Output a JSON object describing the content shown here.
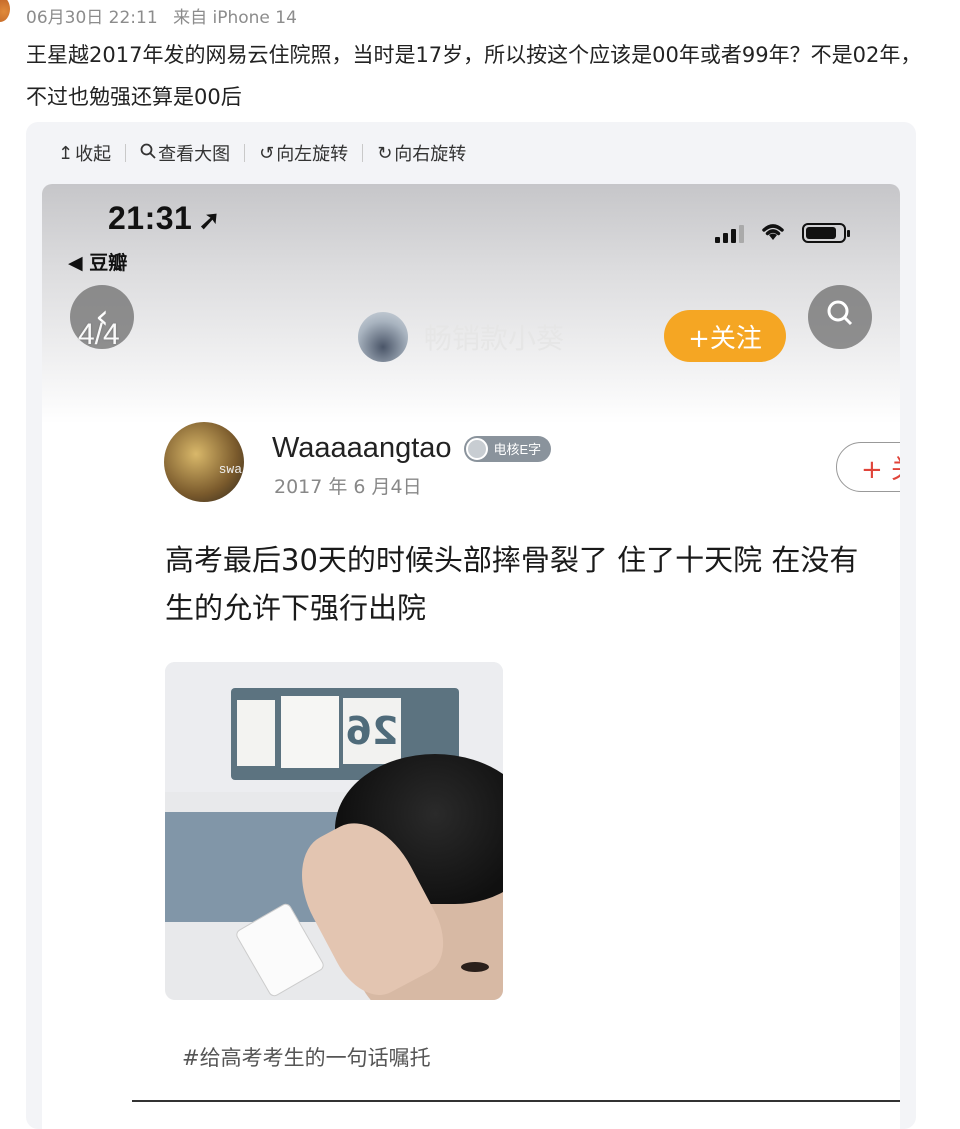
{
  "post": {
    "date": "06月30日 22:11",
    "source": "来自 iPhone 14",
    "text": "王星越2017年发的网易云住院照，当时是17岁，所以按这个应该是00年或者99年？不是02年，不过也勉强还算是00后"
  },
  "toolbar": {
    "collapse": "收起",
    "view_large": "查看大图",
    "rotate_left": "向左旋转",
    "rotate_right": "向右旋转"
  },
  "screenshot": {
    "status_bar": {
      "time": "21:31",
      "back_app": "◀ 豆瓣"
    },
    "page_counter": "4/4",
    "top_author_name": "畅销款小葵",
    "follow_button": "+关注",
    "author": {
      "avatar_text": "swa",
      "username": "Waaaaangtao",
      "badge": "电核E字",
      "date": "2017 年 6 月4日",
      "follow_button": "+ 关"
    },
    "body": "高考最后30天的时候头部摔骨裂了 住了十天院 在没有",
    "body_line2": "生的允许下强行出院",
    "photo_number": "26",
    "hashtag": "#给高考考生的一句话嘱托"
  },
  "colors": {
    "accent_orange": "#f5a623",
    "follow_red": "#e0443a",
    "meta_gray": "#8c8c8c"
  },
  "icons": [
    "collapse-icon",
    "search-icon",
    "rotate-left-icon",
    "rotate-right-icon",
    "location-arrow-icon",
    "signal-icon",
    "wifi-icon",
    "battery-icon",
    "back-chevron-icon"
  ]
}
